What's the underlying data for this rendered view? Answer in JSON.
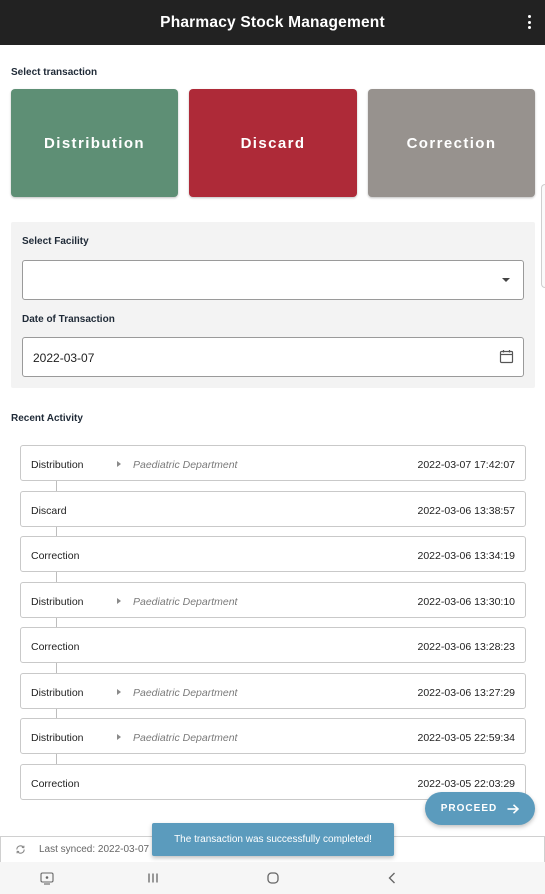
{
  "app": {
    "title": "Pharmacy Stock Management",
    "menu_icon": "more-vert-icon"
  },
  "select_transaction": {
    "label": "Select transaction",
    "buttons": [
      {
        "label": "Distribution",
        "color": "#5e8f75"
      },
      {
        "label": "Discard",
        "color": "#ae2a38"
      },
      {
        "label": "Correction",
        "color": "#97928e"
      }
    ]
  },
  "form": {
    "facility_label": "Select Facility",
    "facility_value": "",
    "date_label": "Date of Transaction",
    "date_value": "2022-03-07"
  },
  "recent": {
    "label": "Recent Activity",
    "items": [
      {
        "type": "Distribution",
        "department": "Paediatric Department",
        "timestamp": "2022-03-07 17:42:07"
      },
      {
        "type": "Discard",
        "department": "",
        "timestamp": "2022-03-06 13:38:57"
      },
      {
        "type": "Correction",
        "department": "",
        "timestamp": "2022-03-06 13:34:19"
      },
      {
        "type": "Distribution",
        "department": "Paediatric Department",
        "timestamp": "2022-03-06 13:30:10"
      },
      {
        "type": "Correction",
        "department": "",
        "timestamp": "2022-03-06 13:28:23"
      },
      {
        "type": "Distribution",
        "department": "Paediatric Department",
        "timestamp": "2022-03-06 13:27:29"
      },
      {
        "type": "Distribution",
        "department": "Paediatric Department",
        "timestamp": "2022-03-05 22:59:34"
      },
      {
        "type": "Correction",
        "department": "",
        "timestamp": "2022-03-05 22:03:29"
      }
    ]
  },
  "proceed": {
    "label": "PROCEED",
    "color": "#5b9bbd"
  },
  "toast": {
    "message": "The transaction was successfully completed!"
  },
  "sync": {
    "text": "Last synced:  2022-03-07"
  }
}
